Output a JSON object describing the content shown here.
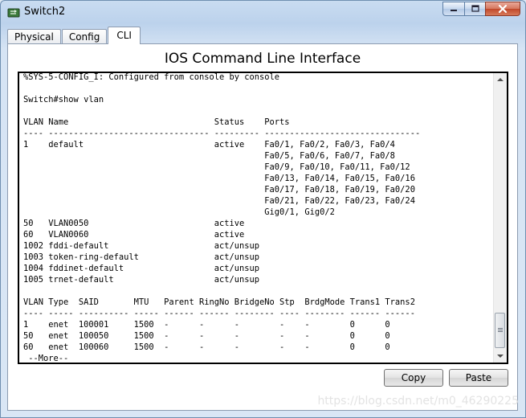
{
  "window": {
    "title": "Switch2",
    "controls": {
      "minimize_icon": "minimize-icon",
      "maximize_icon": "maximize-icon",
      "close_icon": "close-icon"
    }
  },
  "tabs": [
    {
      "label": "Physical",
      "active": false
    },
    {
      "label": "Config",
      "active": false
    },
    {
      "label": "CLI",
      "active": true
    }
  ],
  "cli": {
    "heading": "IOS Command Line Interface",
    "console_output": "%SYS-5-CONFIG_I: Configured from console by console\n\nSwitch#show vlan\n\nVLAN Name                             Status    Ports\n---- -------------------------------- --------- -------------------------------\n1    default                          active    Fa0/1, Fa0/2, Fa0/3, Fa0/4\n                                                Fa0/5, Fa0/6, Fa0/7, Fa0/8\n                                                Fa0/9, Fa0/10, Fa0/11, Fa0/12\n                                                Fa0/13, Fa0/14, Fa0/15, Fa0/16\n                                                Fa0/17, Fa0/18, Fa0/19, Fa0/20\n                                                Fa0/21, Fa0/22, Fa0/23, Fa0/24\n                                                Gig0/1, Gig0/2\n50   VLAN0050                         active\n60   VLAN0060                         active\n1002 fddi-default                     act/unsup\n1003 token-ring-default               act/unsup\n1004 fddinet-default                  act/unsup\n1005 trnet-default                    act/unsup\n\nVLAN Type  SAID       MTU   Parent RingNo BridgeNo Stp  BrdgMode Trans1 Trans2\n---- ----- ---------- ----- ------ ------ -------- ---- -------- ------ ------\n1    enet  100001     1500  -      -      -        -    -        0      0\n50   enet  100050     1500  -      -      -        -    -        0      0\n60   enet  100060     1500  -      -      -        -    -        0      0\n --More--",
    "copy_label": "Copy",
    "paste_label": "Paste"
  },
  "watermark": "https://blog.csdn.net/m0_46290225",
  "colors": {
    "titlebar": "#c9dcf1",
    "close_button": "#c1482b",
    "console_border": "#000000"
  }
}
